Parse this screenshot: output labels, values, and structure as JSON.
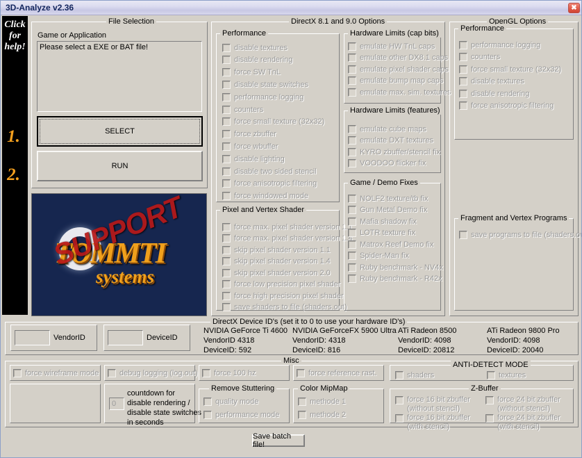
{
  "window": {
    "title": "3D-Analyze v2.36",
    "close_label": "✖"
  },
  "sidebar": {
    "help_line1": "Click",
    "help_line2": "for",
    "help_line3": "help!",
    "step1": "1.",
    "step2": "2.",
    "accent_color": "#f5a01e"
  },
  "file_selection": {
    "group_title": "File Selection",
    "label": "Game or Application",
    "file_value": "Please select a EXE or BAT file!",
    "select_button": "SELECT",
    "run_button": "RUN"
  },
  "logo": {
    "brand": "TOMMTI",
    "brand_sub": "systems",
    "stamp": "SUPPORT",
    "brand_color": "#f0a01c",
    "stamp_color": "#b81818",
    "background_color": "#16264f"
  },
  "directx": {
    "group_title": "DirectX 8.1 and 9.0 Options",
    "performance": {
      "title": "Performance",
      "items": [
        "disable textures",
        "disable rendering",
        "force SW TnL",
        "disable state switches",
        "performance logging",
        "counters",
        "force small texture (32x32)",
        "force zbuffer",
        "force wbuffer",
        "disable lighting",
        "disable two sided stencil",
        "force anisotropic filtering",
        "force windowed mode"
      ]
    },
    "pixel_vertex_shader": {
      "title": "Pixel and Vertex Shader",
      "items": [
        "force max. pixel shader version 1.1",
        "force max. pixel shader version 1.4",
        "skip pixel shader version 1.1",
        "skip pixel shader version 1.4",
        "skip pixel shader version 2.0",
        "force low precision pixel shader",
        "force high precision pixel shader",
        "save shaders to file (shaders.out)"
      ]
    },
    "hardware_limits_cap_bits": {
      "title": "Hardware Limits (cap bits)",
      "items": [
        "emulate HW TnL caps",
        "emulate other DX8.1 caps",
        "emulate pixel shader caps",
        "emulate bump map caps",
        "emulate max. sim. textures"
      ]
    },
    "hardware_limits_features": {
      "title": "Hardware Limits (features)",
      "items": [
        "emulate cube maps",
        "emulate DXT textures",
        "KYRO zbuffer/stencil fix",
        "VOODOO flicker fix"
      ]
    },
    "game_demo_fixes": {
      "title": "Game / Demo Fixes",
      "items": [
        "NOLF2 texture/tb fix",
        "Gun Metal Demo fix",
        "Mafia shadow fix",
        "LOTR texture fix",
        "Matrox Reef Demo fix",
        "Spider-Man fix",
        "Ruby benchmark - NV4x",
        "Ruby benchmark - R42x"
      ]
    }
  },
  "opengl": {
    "group_title": "OpenGL Options",
    "performance": {
      "title": "Performance",
      "items": [
        "performance logging",
        "counters",
        "force small texture (32x32)",
        "disable textures",
        "disable rendering",
        "force anisotropic filtering"
      ]
    },
    "fragment_vertex_programs": {
      "title": "Fragment and Vertex Programs",
      "items": [
        "save programs to file (shaders.out)"
      ]
    }
  },
  "device_ids": {
    "group_title": "DirectX Device ID's (set it to 0 to use your hardware ID's)",
    "vendor_id_label": "VendorID",
    "device_id_label": "DeviceID",
    "vendor_id_value": "",
    "device_id_value": "",
    "reference_cards": [
      {
        "name": "NVIDIA GeForce Ti 4600",
        "vendor": "VendorID 4318",
        "device": "DeviceID: 592"
      },
      {
        "name": "NVIDIA GeForceFX 5900 Ultra",
        "vendor": "VendorID: 4318",
        "device": "DeviceID: 816"
      },
      {
        "name": "ATi Radeon 8500",
        "vendor": "VendorID: 4098",
        "device": "DeviceID: 20812"
      },
      {
        "name": "ATi Radeon 9800 Pro",
        "vendor": "VendorID: 4098",
        "device": "DeviceID: 20040"
      }
    ]
  },
  "misc": {
    "group_title": "Misc",
    "force_wireframe": "force wireframe mode",
    "debug_logging": "debug logging (log.out)",
    "force_100hz": "force 100 hz",
    "force_reference_rast": "force reference rast.",
    "countdown": {
      "value": "0",
      "line1": "countdown for",
      "line2": "disable rendering /",
      "line3": "disable state switches",
      "line4": "in seconds"
    },
    "remove_stuttering": {
      "title": "Remove Stuttering",
      "items": [
        "quality mode",
        "performance mode"
      ]
    },
    "color_mipmap": {
      "title": "Color MipMap",
      "items": [
        "methode 1",
        "methode 2"
      ]
    },
    "anti_detect_mode": {
      "title": "ANTI-DETECT MODE",
      "items": [
        "shaders",
        "textures"
      ]
    },
    "zbuffer": {
      "title": "Z-Buffer",
      "items": [
        {
          "line1": "force 16 bit zbuffer",
          "line2": "(without stencil)"
        },
        {
          "line1": "force 16 bit zbuffer",
          "line2": "(with stencil)"
        },
        {
          "line1": "force 24 bit zbuffer",
          "line2": "(without stencil)"
        },
        {
          "line1": "force 24 bit zbuffer",
          "line2": "(with stencil)"
        }
      ]
    }
  },
  "footer": {
    "save_batch_button": "Save batch file!"
  }
}
